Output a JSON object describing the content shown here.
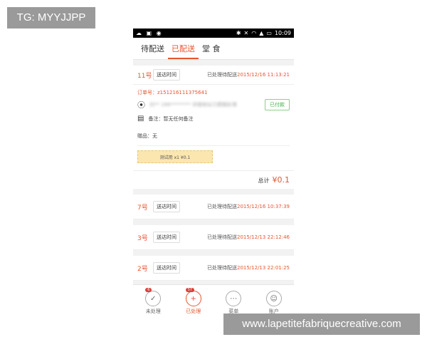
{
  "watermarks": {
    "top": "TG: MYYJJPP",
    "bottom": "www.lapetitefabriquecreative.com"
  },
  "status_bar": {
    "time": "10:09",
    "left_icons": [
      "weather-icon",
      "image-icon",
      "cat-icon"
    ],
    "right_icons": [
      "bluetooth-icon",
      "mute-icon",
      "wifi-icon",
      "signal-icon",
      "battery-icon"
    ]
  },
  "tabs": [
    {
      "label": "待配送",
      "active": false
    },
    {
      "label": "已配送",
      "active": true
    },
    {
      "label": "堂 食",
      "active": false
    }
  ],
  "orders": [
    {
      "number": "11号",
      "time_button": "送达时间",
      "status_text": "已处理待配送",
      "status_time": "2015/12/16 11:13:21",
      "expanded": true,
      "order_no": "订单号：z151216111375641",
      "address_blurred": "刘** 186******** 详细地址已模糊处理",
      "paid_label": "已付款",
      "note": "备注：暂无任何备注",
      "gift": "赠品：无",
      "item": "测试用   x1   ¥0.1",
      "total_label": "总计",
      "total_amount": "¥0.1"
    },
    {
      "number": "7号",
      "time_button": "送达时间",
      "status_text": "已处理待配送",
      "status_time": "2015/12/16 10:37:39"
    },
    {
      "number": "3号",
      "time_button": "送达时间",
      "status_text": "已处理待配送",
      "status_time": "2015/12/13 22:12:46"
    },
    {
      "number": "2号",
      "time_button": "送达时间",
      "status_text": "已处理待配送",
      "status_time": "2015/12/13 22:01:25"
    }
  ],
  "bottom_nav": [
    {
      "label": "未处理",
      "icon": "check-circle-icon",
      "badge": "6",
      "active": false
    },
    {
      "label": "已处理",
      "icon": "plus-circle-icon",
      "badge": "57",
      "active": true
    },
    {
      "label": "菜单",
      "icon": "dots-circle-icon",
      "active": false
    },
    {
      "label": "账户",
      "icon": "user-circle-icon",
      "active": false
    }
  ],
  "colors": {
    "accent": "#e8542f",
    "paid": "#4caf50",
    "item_box": "#fbe6b0"
  }
}
